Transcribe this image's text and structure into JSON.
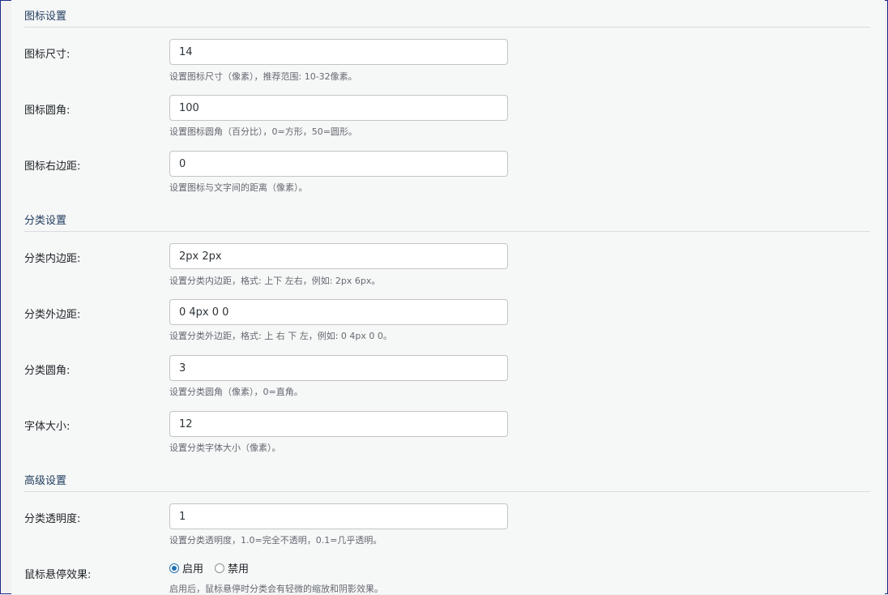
{
  "sections": [
    {
      "title": "图标设置"
    },
    {
      "title": "分类设置"
    },
    {
      "title": "高级设置"
    }
  ],
  "fields": [
    {
      "label": "图标尺寸:",
      "value": "14",
      "description": "设置图标尺寸（像素），推荐范围: 10-32像素。"
    },
    {
      "label": "图标圆角:",
      "value": "100",
      "description": "设置图标圆角（百分比），0=方形，50=圆形。"
    },
    {
      "label": "图标右边距:",
      "value": "0",
      "description": "设置图标与文字间的距离（像素）。"
    },
    {
      "label": "分类内边距:",
      "value": "2px 2px",
      "description": "设置分类内边距，格式: 上下 左右，例如: 2px 6px。"
    },
    {
      "label": "分类外边距:",
      "value": "0 4px 0 0",
      "description": "设置分类外边距，格式: 上 右 下 左，例如: 0 4px 0 0。"
    },
    {
      "label": "分类圆角:",
      "value": "3",
      "description": "设置分类圆角（像素），0=直角。"
    },
    {
      "label": "字体大小:",
      "value": "12",
      "description": "设置分类字体大小（像素）。"
    },
    {
      "label": "分类透明度:",
      "value": "1",
      "description": "设置分类透明度，1.0=完全不透明，0.1=几乎透明。"
    }
  ],
  "hover_effect": {
    "label": "鼠标悬停效果:",
    "options": [
      "启用",
      "禁用"
    ],
    "selected": "启用",
    "description": "启用后，鼠标悬停时分类会有轻微的缩放和阴影效果。"
  },
  "colors": {
    "accent": "#2271b1",
    "section_title": "#1d3b5c",
    "frame_border": "#1e2a8c"
  }
}
